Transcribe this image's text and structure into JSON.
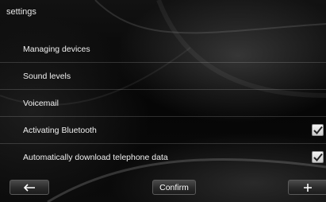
{
  "header": {
    "title": "settings"
  },
  "menu": {
    "items": [
      {
        "label": "Managing devices"
      },
      {
        "label": "Sound levels"
      },
      {
        "label": "Voicemail"
      },
      {
        "label": "Activating Bluetooth",
        "checked": true
      },
      {
        "label": "Automatically download telephone data",
        "checked": true
      }
    ]
  },
  "footer": {
    "back_icon": "arrow-left-icon",
    "confirm_label": "Confirm",
    "add_icon": "plus-icon"
  },
  "colors": {
    "background": "#000000",
    "text": "#ffffff",
    "button": "#333333"
  }
}
